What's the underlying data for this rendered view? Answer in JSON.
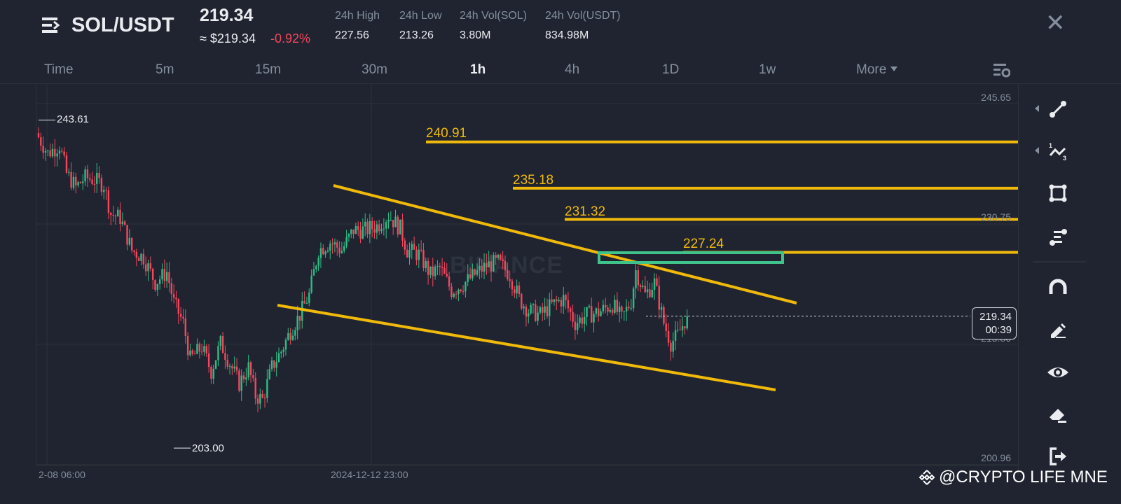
{
  "header": {
    "pair": "SOL/USDT",
    "last_price": "219.34",
    "approx_usd": "≈ $219.34",
    "change_pct": "-0.92%",
    "stats": [
      {
        "label": "24h High",
        "value": "227.56"
      },
      {
        "label": "24h Low",
        "value": "213.26"
      },
      {
        "label": "24h Vol(SOL)",
        "value": "3.80M"
      },
      {
        "label": "24h Vol(USDT)",
        "value": "834.98M"
      }
    ],
    "close_icon": "close-icon"
  },
  "timeframes": [
    {
      "label": "Time",
      "active": false
    },
    {
      "label": "5m",
      "active": false
    },
    {
      "label": "15m",
      "active": false
    },
    {
      "label": "30m",
      "active": false
    },
    {
      "label": "1h",
      "active": true
    },
    {
      "label": "4h",
      "active": false
    },
    {
      "label": "1D",
      "active": false
    },
    {
      "label": "1w",
      "active": false
    },
    {
      "label": "More",
      "active": false
    }
  ],
  "chart": {
    "price_axis": [
      "245.65",
      "230.75",
      "215.86",
      "200.96"
    ],
    "time_axis": [
      "2-08 06:00",
      "2024-12-12 23:00"
    ],
    "high_marker": "243.61",
    "low_marker": "203.00",
    "levels": [
      "240.91",
      "235.18",
      "231.32",
      "227.24"
    ],
    "current_price": "219.34",
    "countdown": "00:39",
    "watermark": "BINANCE",
    "colors": {
      "up": "#2ebd85",
      "down": "#f6465d",
      "drawing": "#f0b90b",
      "box": "#3fc38a"
    },
    "price_waypoints": [
      [
        0,
        241.5
      ],
      [
        4,
        239.5
      ],
      [
        9,
        240.5
      ],
      [
        12,
        237
      ],
      [
        16,
        235.3
      ],
      [
        20,
        236.5
      ],
      [
        24,
        236.2
      ],
      [
        28,
        235.6
      ],
      [
        31,
        232
      ],
      [
        35,
        231.5
      ],
      [
        40,
        227.5
      ],
      [
        45,
        226.6
      ],
      [
        50,
        223.5
      ],
      [
        55,
        224.8
      ],
      [
        58,
        221
      ],
      [
        62,
        218.5
      ],
      [
        65,
        214
      ],
      [
        70,
        215.5
      ],
      [
        74,
        212.5
      ],
      [
        78,
        216
      ],
      [
        82,
        213.5
      ],
      [
        86,
        211
      ],
      [
        90,
        213
      ],
      [
        93,
        209.5
      ],
      [
        96,
        209
      ],
      [
        100,
        213
      ],
      [
        104,
        215
      ],
      [
        108,
        217.5
      ],
      [
        112,
        219.5
      ],
      [
        116,
        222
      ],
      [
        120,
        227.5
      ],
      [
        125,
        228.5
      ],
      [
        130,
        227.5
      ],
      [
        135,
        230
      ],
      [
        140,
        230
      ],
      [
        145,
        230.5
      ],
      [
        150,
        231.8
      ],
      [
        155,
        230.2
      ],
      [
        158,
        227.5
      ],
      [
        163,
        227
      ],
      [
        168,
        224.5
      ],
      [
        172,
        225.3
      ],
      [
        177,
        222.5
      ],
      [
        182,
        223.3
      ],
      [
        187,
        224.5
      ],
      [
        192,
        225.6
      ],
      [
        197,
        226
      ],
      [
        202,
        224.5
      ],
      [
        206,
        221.5
      ],
      [
        210,
        220
      ],
      [
        215,
        219.5
      ],
      [
        220,
        220.7
      ],
      [
        225,
        221.5
      ],
      [
        230,
        218.5
      ],
      [
        235,
        219.5
      ],
      [
        240,
        219.8
      ],
      [
        246,
        220.8
      ],
      [
        250,
        219
      ],
      [
        254,
        221.2
      ],
      [
        256,
        225
      ],
      [
        260,
        222
      ],
      [
        264,
        223.5
      ],
      [
        268,
        218.5
      ],
      [
        271,
        216
      ],
      [
        274,
        217
      ],
      [
        278,
        219.34
      ]
    ]
  },
  "toolbar": {
    "tools": [
      "trend-line-icon",
      "fib-icon",
      "rectangle-icon",
      "levels-icon",
      "magnet-icon",
      "pencil-icon",
      "eye-icon",
      "eraser-icon",
      "exit-icon"
    ]
  },
  "credit": "@CRYPTO LIFE MNE"
}
